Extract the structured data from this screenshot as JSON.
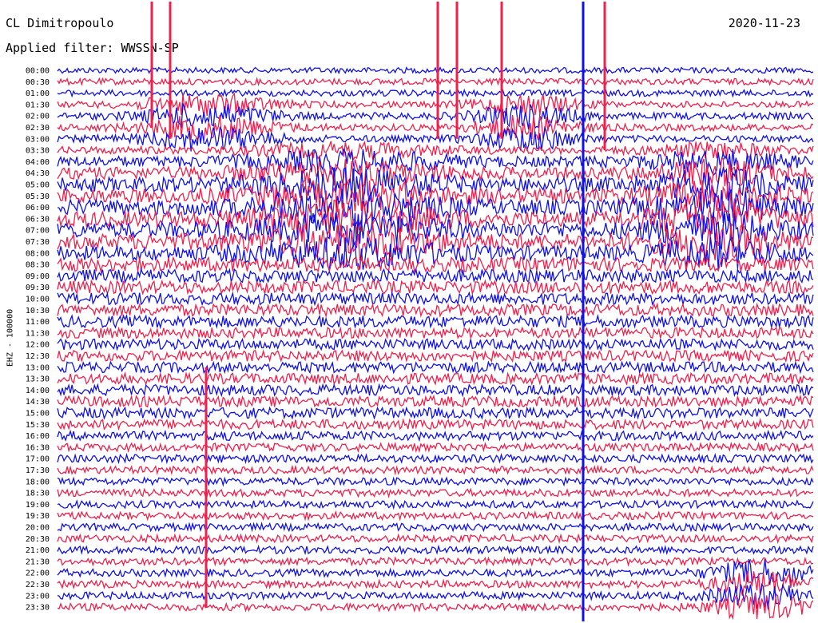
{
  "header": {
    "station": "CL Dimitropoulo",
    "date": "2020-11-23",
    "filter_label": "Applied filter: WWSSN-SP"
  },
  "axis": {
    "channel_label": "EHZ - 100000"
  },
  "colors": {
    "trace_a": "#1010e8",
    "trace_b": "#f0204c",
    "background": "#ffffff",
    "text": "#000000"
  },
  "chart_data": {
    "type": "line",
    "title": "",
    "ylabel": "EHZ - 100000",
    "date": "2020-11-23",
    "filter": "WWSSN-SP",
    "series_colors": [
      "#1010e8",
      "#f0204c"
    ],
    "row_labels": [
      "00:00",
      "00:30",
      "01:00",
      "01:30",
      "02:00",
      "02:30",
      "03:00",
      "03:30",
      "04:00",
      "04:30",
      "05:00",
      "05:30",
      "06:00",
      "06:30",
      "07:00",
      "07:30",
      "08:00",
      "08:30",
      "09:00",
      "09:30",
      "10:00",
      "10:30",
      "11:00",
      "11:30",
      "12:00",
      "12:30",
      "13:00",
      "13:30",
      "14:00",
      "14:30",
      "15:00",
      "15:30",
      "16:00",
      "16:30",
      "17:00",
      "17:30",
      "18:00",
      "18:30",
      "19:00",
      "19:30",
      "20:00",
      "20:30",
      "21:00",
      "21:30",
      "22:00",
      "22:30",
      "23:00",
      "23:30"
    ],
    "row_noise_level": [
      0.15,
      0.2,
      0.2,
      0.2,
      0.25,
      0.25,
      0.25,
      0.3,
      0.6,
      0.7,
      0.9,
      0.9,
      1.0,
      1.0,
      1.0,
      1.0,
      0.9,
      0.9,
      0.8,
      0.8,
      0.7,
      0.7,
      0.7,
      0.6,
      0.6,
      0.6,
      0.6,
      0.6,
      0.6,
      0.6,
      0.6,
      0.5,
      0.45,
      0.35,
      0.35,
      0.3,
      0.3,
      0.3,
      0.3,
      0.3,
      0.3,
      0.3,
      0.3,
      0.3,
      0.3,
      0.3,
      0.3,
      0.3
    ]
  }
}
